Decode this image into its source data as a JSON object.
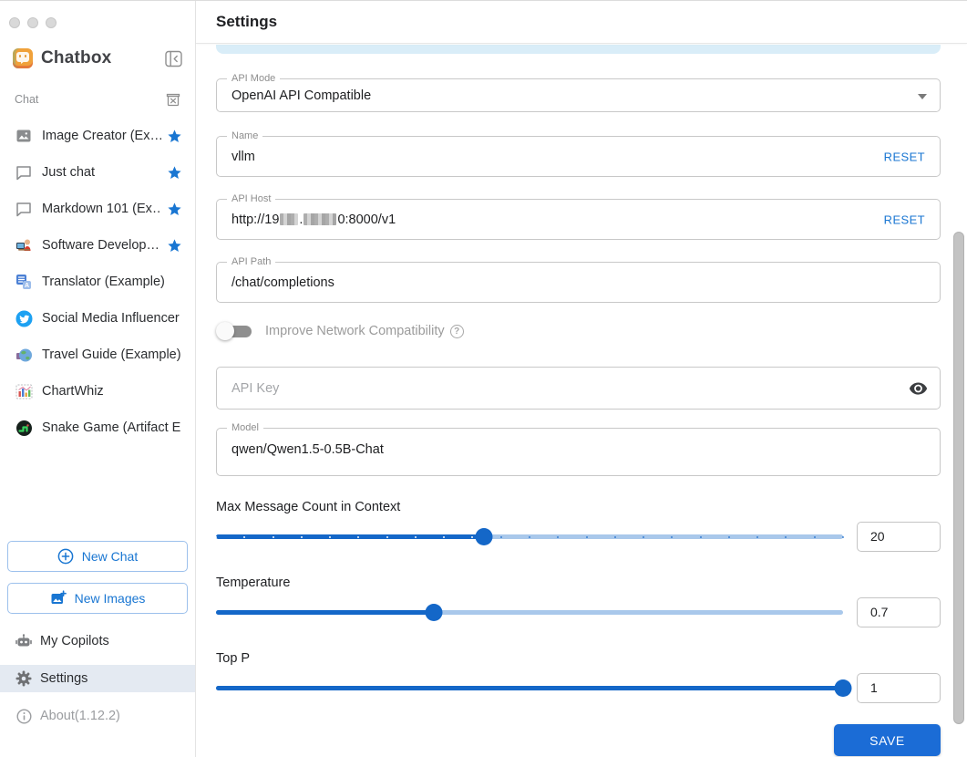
{
  "window": {
    "traffic_lights": [
      "close",
      "minimize",
      "zoom"
    ]
  },
  "sidebar": {
    "app_name": "Chatbox",
    "section_label": "Chat",
    "items": [
      {
        "label": "Image Creator (Ex…",
        "icon": "image-icon",
        "starred": true
      },
      {
        "label": "Just chat",
        "icon": "chat-bubble-icon",
        "starred": true
      },
      {
        "label": "Markdown 101 (Ex…",
        "icon": "chat-bubble-icon",
        "starred": true
      },
      {
        "label": "Software Develop…",
        "icon": "developer-emoji-icon",
        "starred": true
      },
      {
        "label": "Translator (Example)",
        "icon": "translate-icon",
        "starred": false
      },
      {
        "label": "Social Media Influencer …",
        "icon": "twitter-icon",
        "starred": false
      },
      {
        "label": "Travel Guide (Example)",
        "icon": "globe-icon",
        "starred": false
      },
      {
        "label": "ChartWhiz",
        "icon": "bar-chart-icon",
        "starred": false
      },
      {
        "label": "Snake Game (Artifact E…",
        "icon": "snake-game-icon",
        "starred": false
      }
    ],
    "new_chat_label": "New Chat",
    "new_images_label": "New Images",
    "my_copilots_label": "My Copilots",
    "settings_label": "Settings",
    "about_label": "About(1.12.2)"
  },
  "header": {
    "title": "Settings"
  },
  "form": {
    "api_mode": {
      "label": "API Mode",
      "value": "OpenAI API Compatible"
    },
    "name": {
      "label": "Name",
      "value": "vllm",
      "reset_label": "RESET"
    },
    "api_host": {
      "label": "API Host",
      "value_prefix": "http://19",
      "value_mid": ".",
      "value_suffix": "0:8000/v1",
      "redacted": true,
      "reset_label": "RESET"
    },
    "api_path": {
      "label": "API Path",
      "value": "/chat/completions"
    },
    "network_toggle": {
      "label": "Improve Network Compatibility",
      "state": "off"
    },
    "api_key": {
      "placeholder": "API Key"
    },
    "model": {
      "label": "Model",
      "value": "qwen/Qwen1.5-0.5B-Chat"
    },
    "sliders": [
      {
        "label": "Max Message Count in Context",
        "value": "20",
        "percent": 42.7,
        "marks": 23
      },
      {
        "label": "Temperature",
        "value": "0.7",
        "percent": 34.8,
        "marks": 0
      },
      {
        "label": "Top P",
        "value": "1",
        "percent": 100,
        "marks": 0
      }
    ],
    "save_label": "SAVE"
  },
  "colors": {
    "accent_blue": "#1976d2",
    "save_button": "#1b6cd6",
    "slider_fill": "#1467c8",
    "slider_track": "#a9c8eb",
    "active_row_bg": "#e4eaf2",
    "tab_remnant_bg": "#d9edf8",
    "field_border": "#c8c8c8"
  }
}
